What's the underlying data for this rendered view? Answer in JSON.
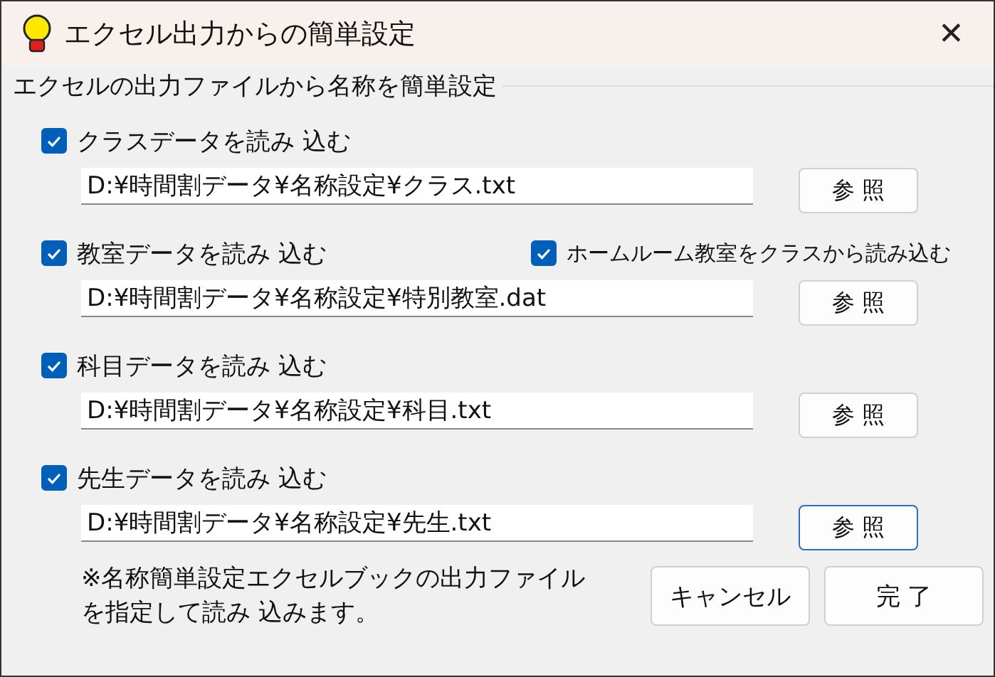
{
  "window": {
    "title": "エクセル出力からの簡単設定",
    "close": "✕"
  },
  "group": {
    "title": "エクセルの出力ファイルから名称を簡単設定"
  },
  "sections": [
    {
      "label": "クラスデータを読み 込む",
      "checked": true,
      "path": "D:¥時間割データ¥名称設定¥クラス.txt",
      "browse": "参 照",
      "focused": false
    },
    {
      "label": "教室データを読み 込む",
      "checked": true,
      "extra": {
        "label": "ホームルーム教室をクラスから読み込む",
        "checked": true
      },
      "path": "D:¥時間割データ¥名称設定¥特別教室.dat",
      "browse": "参 照",
      "focused": false
    },
    {
      "label": "科目データを読み 込む",
      "checked": true,
      "path": "D:¥時間割データ¥名称設定¥科目.txt",
      "browse": "参 照",
      "focused": false
    },
    {
      "label": "先生データを読み 込む",
      "checked": true,
      "path": "D:¥時間割データ¥名称設定¥先生.txt",
      "browse": "参 照",
      "focused": true
    }
  ],
  "note": "※名称簡単設定エクセルブックの出力ファイルを指定して読み 込みます。",
  "buttons": [
    "キャンセル",
    "完 了"
  ]
}
